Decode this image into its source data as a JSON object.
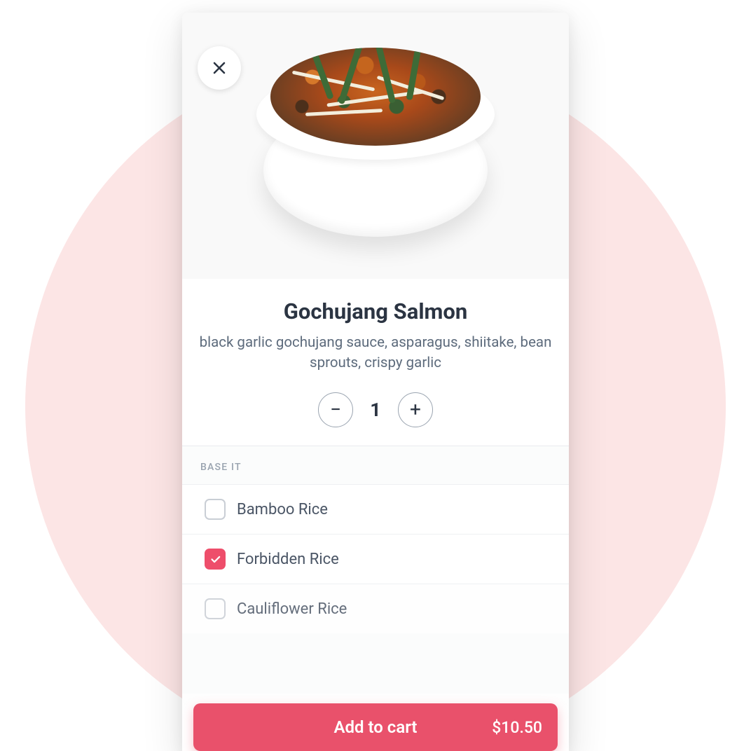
{
  "product": {
    "title": "Gochujang Salmon",
    "description": "black garlic gochujang sauce, asparagus, shiitake, bean sprouts, crispy garlic",
    "quantity": "1"
  },
  "section": {
    "label": "BASE IT",
    "options": [
      {
        "label": "Bamboo Rice",
        "checked": false
      },
      {
        "label": "Forbidden Rice",
        "checked": true
      },
      {
        "label": "Cauliflower Rice",
        "checked": false
      }
    ]
  },
  "footer": {
    "add_label": "Add to cart",
    "price": "$10.50"
  },
  "colors": {
    "accent": "#e9516b",
    "bg_circle": "#fce5e5"
  }
}
